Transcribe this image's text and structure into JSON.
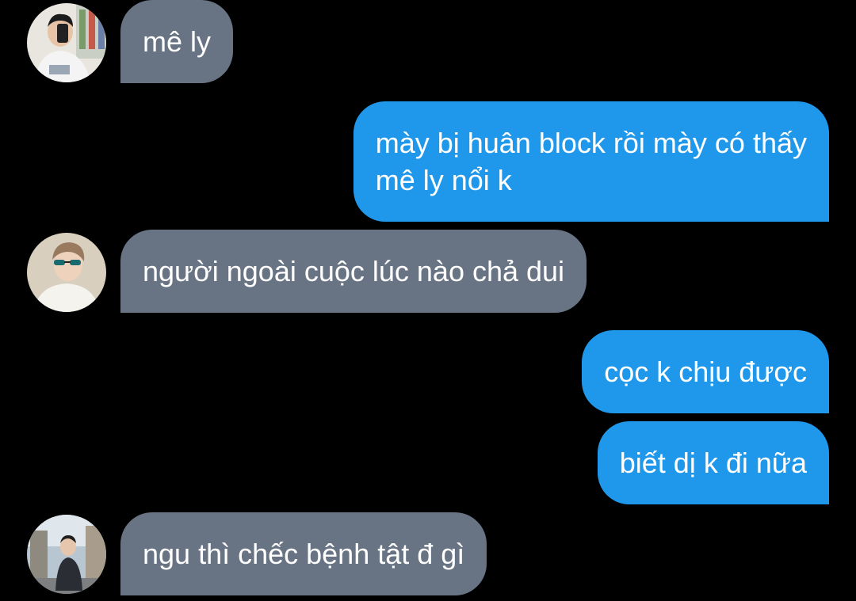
{
  "messages": [
    {
      "direction": "incoming",
      "text": "mê ly",
      "avatar": "avatar-boy-mirror-selfie"
    },
    {
      "direction": "outgoing",
      "line1": "mày bị huân block rồi mày có thấy",
      "line2": "mê ly nổi k"
    },
    {
      "direction": "incoming",
      "text": "người ngoài cuộc lúc nào chả dui",
      "avatar": "avatar-boy-sunglasses"
    },
    {
      "direction": "outgoing",
      "text": "cọc k chịu được"
    },
    {
      "direction": "outgoing",
      "text": "biết dị k đi nữa"
    },
    {
      "direction": "incoming",
      "text": "ngu thì chếc bệnh tật đ gì",
      "avatar": "avatar-boy-street"
    }
  ],
  "colors": {
    "background": "#000000",
    "incoming_bubble": "#687484",
    "outgoing_bubble": "#1f98ec",
    "text": "#ffffff"
  }
}
